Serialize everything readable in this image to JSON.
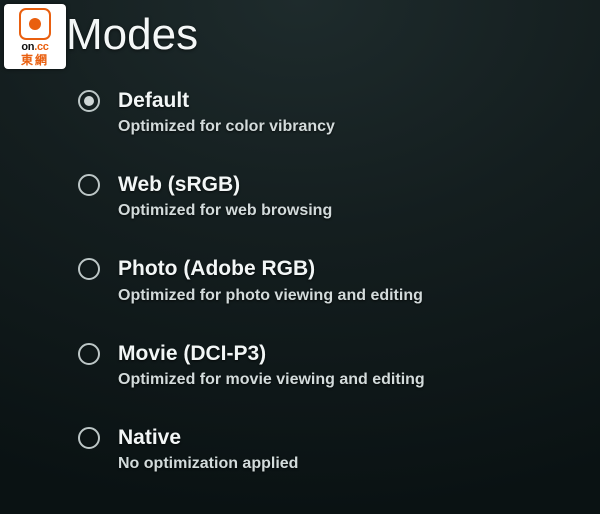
{
  "watermark": {
    "brand_on": "on",
    "brand_cc": ".cc",
    "brand_cn": "東網"
  },
  "title": "Modes",
  "options": [
    {
      "label": "Default",
      "desc": "Optimized for color vibrancy",
      "selected": true
    },
    {
      "label": "Web (sRGB)",
      "desc": "Optimized for web browsing",
      "selected": false
    },
    {
      "label": "Photo (Adobe RGB)",
      "desc": "Optimized for photo viewing and editing",
      "selected": false
    },
    {
      "label": "Movie (DCI-P3)",
      "desc": "Optimized for movie viewing and editing",
      "selected": false
    },
    {
      "label": "Native",
      "desc": "No optimization applied",
      "selected": false
    }
  ]
}
